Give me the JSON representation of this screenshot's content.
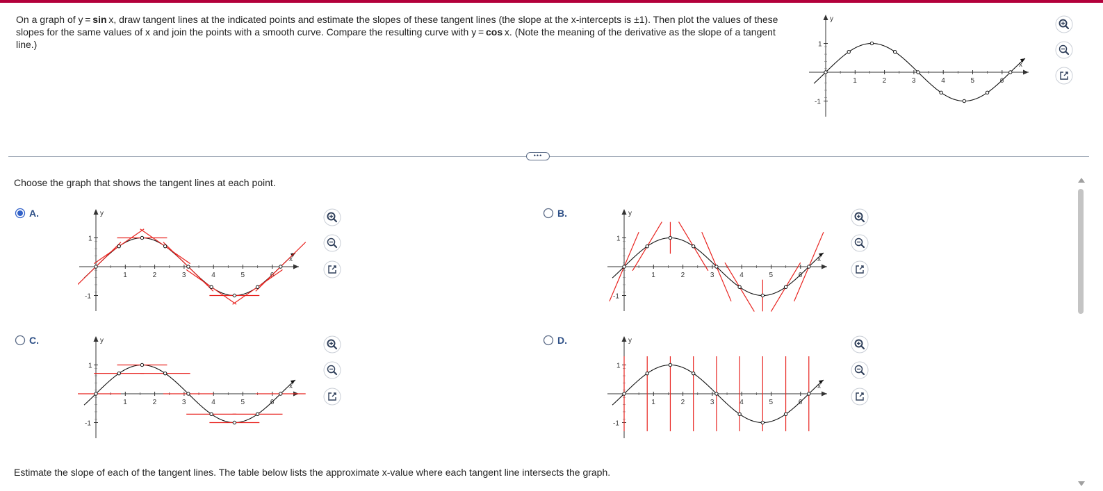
{
  "question": {
    "part1": "On a graph of y = ",
    "func1": "sin",
    "part2": " x, draw tangent lines at the indicated points and estimate the slopes of these tangent lines (the slope at the x-intercepts is ±1). Then plot the values of these slopes for the same values of x and join the points with a smooth curve. Compare the resulting curve with y = ",
    "func2": "cos",
    "part3": " x. (Note the meaning of the derivative as the slope of a tangent line.)"
  },
  "more_button": "•••",
  "prompt": "Choose the graph that shows the tangent lines at each point.",
  "bottom_text": "Estimate the slope of each of the tangent lines. The table below lists the approximate x-value where each tangent line intersects the graph.",
  "options": [
    {
      "id": "A",
      "label": "A.",
      "selected": true,
      "tangents": "correct"
    },
    {
      "id": "B",
      "label": "B.",
      "selected": false,
      "tangents": "steep"
    },
    {
      "id": "C",
      "label": "C.",
      "selected": false,
      "tangents": "horizontal"
    },
    {
      "id": "D",
      "label": "D.",
      "selected": false,
      "tangents": "vertical"
    }
  ],
  "axis_labels": {
    "x": "x",
    "y": "y",
    "x_ticks": [
      "1",
      "2",
      "3",
      "4",
      "5",
      "6"
    ],
    "y_ticks": [
      "1",
      "-1"
    ]
  },
  "icons": [
    "zoom-in-icon",
    "zoom-out-icon",
    "open-window-icon"
  ],
  "colors": {
    "accent": "#b3003b",
    "tangent": "#e8231f",
    "label": "#2d4f86"
  }
}
